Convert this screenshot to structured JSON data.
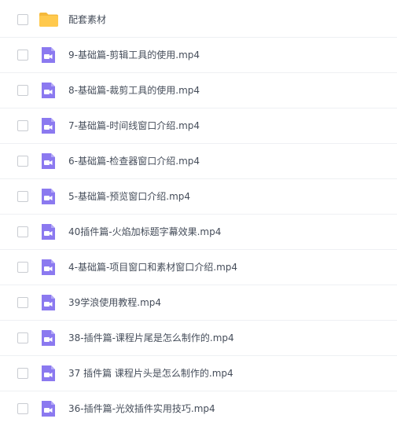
{
  "files": [
    {
      "name": "配套素材",
      "type": "folder",
      "icon": "folder-icon"
    },
    {
      "name": "9-基础篇-剪辑工具的使用.mp4",
      "type": "video",
      "icon": "video-file-icon"
    },
    {
      "name": "8-基础篇-裁剪工具的使用.mp4",
      "type": "video",
      "icon": "video-file-icon"
    },
    {
      "name": "7-基础篇-时间线窗口介绍.mp4",
      "type": "video",
      "icon": "video-file-icon"
    },
    {
      "name": "6-基础篇-检查器窗口介绍.mp4",
      "type": "video",
      "icon": "video-file-icon"
    },
    {
      "name": "5-基础篇-预览窗口介绍.mp4",
      "type": "video",
      "icon": "video-file-icon"
    },
    {
      "name": "40插件篇-火焰加标题字幕效果.mp4",
      "type": "video",
      "icon": "video-file-icon"
    },
    {
      "name": "4-基础篇-项目窗口和素材窗口介绍.mp4",
      "type": "video",
      "icon": "video-file-icon"
    },
    {
      "name": "39学浪使用教程.mp4",
      "type": "video",
      "icon": "video-file-icon"
    },
    {
      "name": "38-插件篇-课程片尾是怎么制作的.mp4",
      "type": "video",
      "icon": "video-file-icon"
    },
    {
      "name": "37 插件篇 课程片头是怎么制作的.mp4",
      "type": "video",
      "icon": "video-file-icon"
    },
    {
      "name": "36-插件篇-光效插件实用技巧.mp4",
      "type": "video",
      "icon": "video-file-icon"
    }
  ],
  "colors": {
    "folder": "#ffc94d",
    "folder_tab": "#f5b93b",
    "video": "#8b79f0",
    "video_fold": "#b3a8f7"
  }
}
